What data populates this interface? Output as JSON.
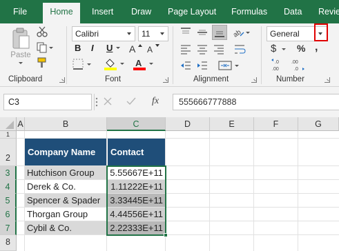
{
  "tabs": [
    "File",
    "Home",
    "Insert",
    "Draw",
    "Page Layout",
    "Formulas",
    "Data",
    "Revie"
  ],
  "active_tab": "Home",
  "groups": {
    "clipboard": {
      "label": "Clipboard",
      "paste": "Paste"
    },
    "font": {
      "label": "Font",
      "font_name": "Calibri",
      "font_size": "11",
      "bold": "B",
      "italic": "I",
      "underline": "U"
    },
    "alignment": {
      "label": "Alignment"
    },
    "number": {
      "label": "Number",
      "format": "General",
      "currency": "$",
      "percent": "%",
      "comma": ","
    }
  },
  "formula_bar": {
    "name_box": "C3",
    "fx": "fx",
    "value": "555666777888"
  },
  "columns": [
    "A",
    "B",
    "C",
    "D",
    "E",
    "F",
    "G"
  ],
  "rows": [
    "1",
    "2",
    "3",
    "4",
    "5",
    "6",
    "7",
    "8"
  ],
  "table": {
    "headers": [
      "Company Name",
      "Contact"
    ],
    "rows": [
      [
        "Hutchison Group",
        "5.55667E+11"
      ],
      [
        "Derek & Co.",
        "1.11222E+11"
      ],
      [
        "Spencer & Spader",
        "3.33445E+11"
      ],
      [
        "Thorgan Group",
        "4.44556E+11"
      ],
      [
        "Cybil & Co.",
        "2.22333E+11"
      ]
    ]
  },
  "colors": {
    "ribbon_green": "#217346",
    "header_fill": "#1f4e79",
    "highlight_box": "#e00000",
    "fill_color_swatch": "#ffff00",
    "font_color_swatch": "#ff0000"
  }
}
